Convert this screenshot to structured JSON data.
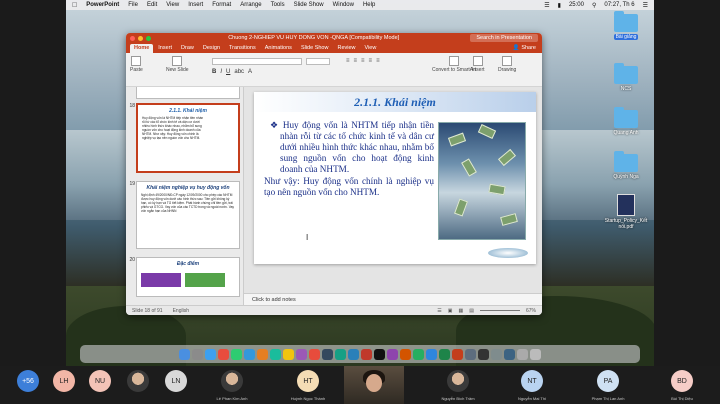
{
  "menubar": {
    "app": "PowerPoint",
    "items": [
      "File",
      "Edit",
      "View",
      "Insert",
      "Format",
      "Arrange",
      "Tools",
      "Slide Show",
      "Window",
      "Help"
    ],
    "battery": "25:00",
    "time": "07:27, Th 6"
  },
  "window": {
    "title": "Chuong 2-NGHIEP VU HUY DONG VON -QNGA [Compatibility Mode]",
    "search_placeholder": "Search in Presentation",
    "tabs": [
      "Home",
      "Insert",
      "Draw",
      "Design",
      "Transitions",
      "Animations",
      "Slide Show",
      "Review",
      "View"
    ],
    "share_label": "Share",
    "ribbon": {
      "paste": "Paste",
      "new_slide": "New Slide",
      "convert": "Convert to SmartArt",
      "insert": "Insert",
      "drawing": "Drawing"
    }
  },
  "thumbnails": [
    {
      "num": "18",
      "title": "2.1.1. Khái niệm",
      "body": "Huy động vốn là NHTM tiếp nhận tiền nhàn rỗi từ các tổ chức kinh tế và dân cư dưới nhiều hình thức khác nhau, nhằm bổ sung nguồn vốn cho hoạt động kinh doanh của NHTM. Như vậy: Huy động vốn chính là nghiệp vụ tạo nên nguồn vốn cho NHTM."
    },
    {
      "num": "19",
      "title": "Khái niệm nghiệp vụ huy động vốn",
      "body": "Nghị định 49/2000/NĐ-CP ngày 12/09/2000 cho phép các NHTM được huy động vốn dưới các hình thức sau: Tiền gửi không kỳ hạn, có kỳ hạn và TG tiết kiệm. Phát hành chứng chỉ tiền gửi, trái phiếu và GTCG. Vay vốn của các TCTD trong và ngoài nước. Vay vốn ngắn hạn của NHNN"
    },
    {
      "num": "20",
      "title": "Đặc điểm",
      "body": ""
    }
  ],
  "slide": {
    "title": "2.1.1. Khái niệm",
    "bullet": "Huy động vốn là NHTM tiếp nhận tiền nhàn rỗi từ các tổ chức kinh tế và dân cư dưới nhiều hình thức khác nhau, nhằm bổ sung nguồn vốn cho hoạt động kinh doanh của NHTM.",
    "para": "Như vậy: Huy động vốn chính là nghiệp vụ tạo nên nguồn vốn cho NHTM."
  },
  "notes_placeholder": "Click to add notes",
  "status": {
    "slide_pos": "Slide 18 of 91",
    "language": "English",
    "zoom": "67%"
  },
  "desktop_icons": [
    {
      "label": "Bài giảng",
      "type": "folder",
      "selected": true
    },
    {
      "label": "NCS",
      "type": "folder",
      "selected": false
    },
    {
      "label": "Quang Anh",
      "type": "folder",
      "selected": false
    },
    {
      "label": "Quỳnh Nga",
      "type": "folder",
      "selected": false
    },
    {
      "label": "Startup_Policy_Kết nối.pdf",
      "type": "pdf",
      "selected": false
    }
  ],
  "participants": [
    {
      "initials": "+56",
      "name": "",
      "color": "#3d7fd9"
    },
    {
      "initials": "LH",
      "name": "",
      "color": "#f2b6a6"
    },
    {
      "initials": "NU",
      "name": "",
      "color": "#f3c3b7"
    },
    {
      "initials": "",
      "name": "",
      "color": "photo"
    },
    {
      "initials": "LN",
      "name": "",
      "color": "#d9d9d9"
    },
    {
      "initials": "",
      "name": "Lê Phan Kim Anh",
      "color": "photo"
    },
    {
      "initials": "HT",
      "name": "Huỳnh Ngọc Thành",
      "color": "#f5ddb5"
    },
    {
      "initials": "",
      "name": "Nguyễn Bích Trâm",
      "color": "photo"
    },
    {
      "initials": "NT",
      "name": "Nguyễn Mai Thi",
      "color": "#b9d3f0"
    },
    {
      "initials": "PA",
      "name": "Phạm Thị Lan Anh",
      "color": "#cfe1f3"
    },
    {
      "initials": "BD",
      "name": "Bùi Thị Diệu",
      "color": "#f6cdc7"
    }
  ]
}
